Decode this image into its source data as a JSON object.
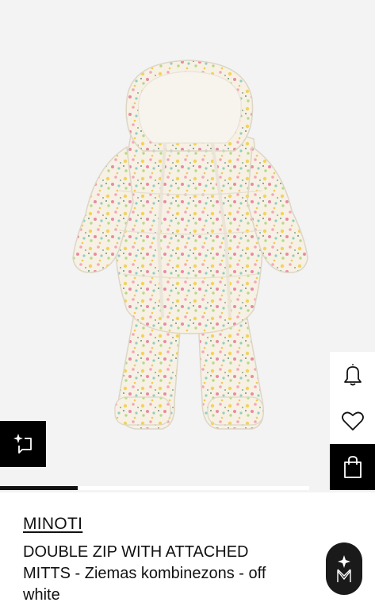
{
  "product": {
    "brand": "MINOTI",
    "title_lines": [
      "DOUBLE ZIP WITH ATTACHED",
      "MITTS - Ziemas kombinezons - off",
      "white"
    ]
  },
  "gallery": {
    "progress": 0.25
  },
  "icons": {
    "notify": "bell-icon",
    "wishlist": "heart-icon",
    "cart": "shopping-bag-icon",
    "ai": "sparkle-chat-icon",
    "fab": "brand-logo-icon"
  },
  "colors": {
    "accent": "#000000",
    "background": "#f3f3f3"
  }
}
